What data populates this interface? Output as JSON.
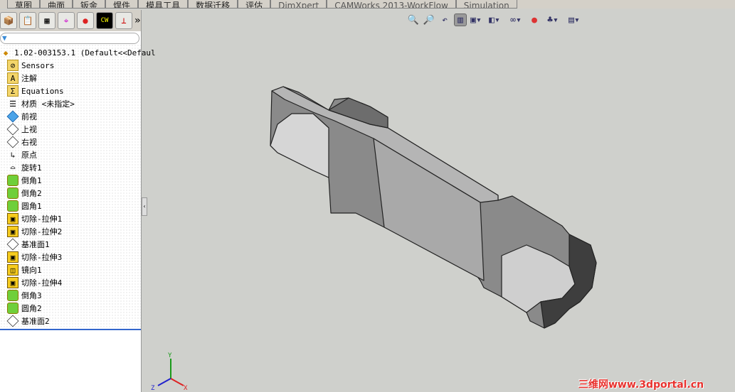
{
  "ribbon_tabs": [
    "草图",
    "曲面",
    "钣金",
    "焊件",
    "模具工具",
    "数据迁移",
    "评估",
    "DimXpert",
    "CAMWorks 2013-WorkFlow",
    "Simulation"
  ],
  "panel": {
    "tab_icons": [
      "assembly-icon",
      "property-manager-icon",
      "configuration-manager-icon",
      "dimxpert-icon",
      "display-manager-icon",
      "camworks-icon",
      "cam-icon"
    ],
    "more": "»",
    "filter_icon": "filter-icon",
    "root": "1.02-003153.1  (Default<<Defaul",
    "items": [
      {
        "label": "Sensors",
        "icon": "sensors-folder-icon"
      },
      {
        "label": "注解",
        "icon": "annotations-folder-icon"
      },
      {
        "label": "Equations",
        "icon": "equations-folder-icon"
      },
      {
        "label": "材质 <未指定>",
        "icon": "material-icon"
      },
      {
        "label": "前视",
        "icon": "plane-icon"
      },
      {
        "label": "上视",
        "icon": "plane-icon"
      },
      {
        "label": "右视",
        "icon": "plane-icon"
      },
      {
        "label": "原点",
        "icon": "origin-icon"
      },
      {
        "label": "旋转1",
        "icon": "revolve-icon"
      },
      {
        "label": "倒角1",
        "icon": "chamfer-icon"
      },
      {
        "label": "倒角2",
        "icon": "chamfer-icon"
      },
      {
        "label": "圆角1",
        "icon": "fillet-icon"
      },
      {
        "label": "切除-拉伸1",
        "icon": "cut-extrude-icon"
      },
      {
        "label": "切除-拉伸2",
        "icon": "cut-extrude-icon"
      },
      {
        "label": "基准面1",
        "icon": "plane-icon"
      },
      {
        "label": "切除-拉伸3",
        "icon": "cut-extrude-icon"
      },
      {
        "label": "镜向1",
        "icon": "mirror-icon"
      },
      {
        "label": "切除-拉伸4",
        "icon": "cut-extrude-icon"
      },
      {
        "label": "倒角3",
        "icon": "chamfer-icon"
      },
      {
        "label": "圆角2",
        "icon": "fillet-icon"
      },
      {
        "label": "基准面2",
        "icon": "plane-icon"
      }
    ]
  },
  "triad": {
    "x": "X",
    "y": "Y",
    "z": "Z"
  },
  "watermark": "三维网www.3dportal.cn"
}
